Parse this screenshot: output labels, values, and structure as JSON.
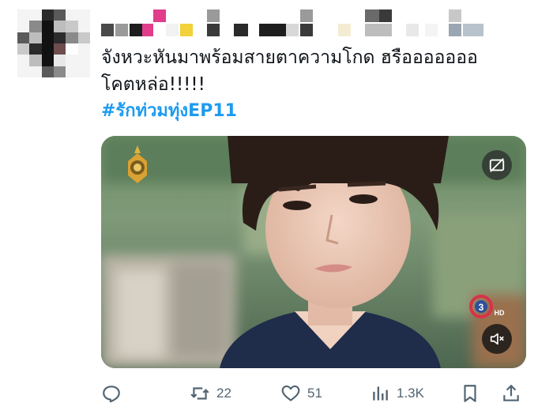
{
  "tweet": {
    "text": "จังหวะหันมาพร้อมสายตาความโกด ฮรือออออออ\nโคตหล่อ!!!!!",
    "hashtag": "#รักท่วมทุ่งEP11"
  },
  "media": {
    "type": "video",
    "cc_icon": "closed-captions-off-icon",
    "mute_icon": "volume-muted-icon",
    "channel_logo": "channel-3-hd-logo",
    "channel_logo_text": "HD"
  },
  "actions": {
    "reply": {
      "icon": "reply-icon",
      "count": ""
    },
    "retweet": {
      "icon": "retweet-icon",
      "count": "22"
    },
    "like": {
      "icon": "heart-icon",
      "count": "51"
    },
    "views": {
      "icon": "views-icon",
      "count": "1.3K"
    },
    "bookmark": {
      "icon": "bookmark-icon"
    },
    "share": {
      "icon": "share-icon"
    }
  },
  "colors": {
    "hashtag": "#1d9bf0",
    "action_gray": "#536471",
    "text": "#0f1419"
  }
}
